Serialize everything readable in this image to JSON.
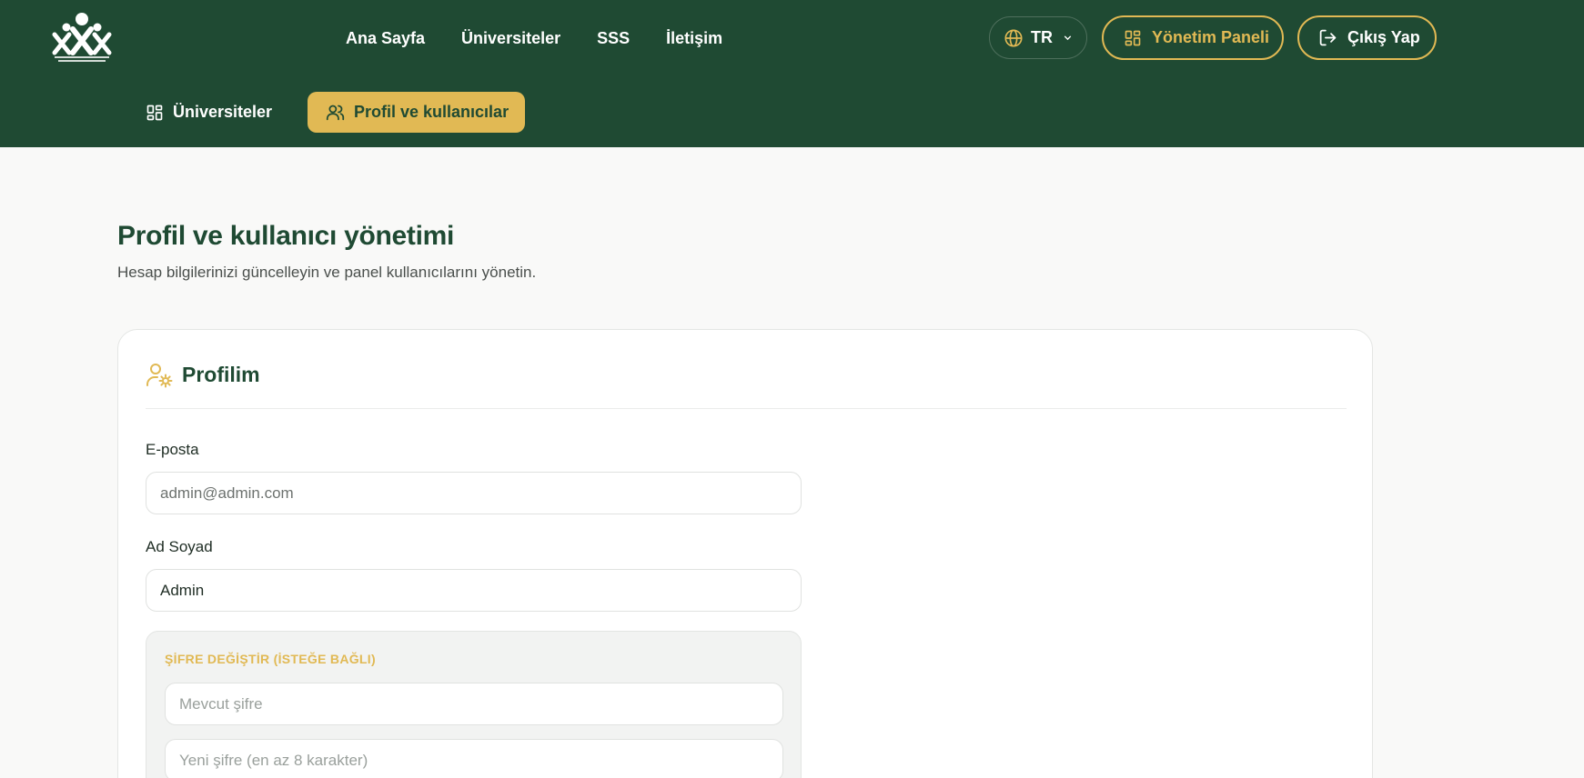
{
  "nav": {
    "items": [
      "Ana Sayfa",
      "Üniversiteler",
      "SSS",
      "İletişim"
    ]
  },
  "lang": {
    "label": "TR"
  },
  "actions": {
    "panel_label": "Yönetim Paneli",
    "logout_label": "Çıkış Yap"
  },
  "subnav": {
    "universities_label": "Üniversiteler",
    "profile_label": "Profil ve kullanıcılar"
  },
  "page": {
    "title": "Profil ve kullanıcı yönetimi",
    "subtitle": "Hesap bilgilerinizi güncelleyin ve panel kullanıcılarını yönetin."
  },
  "profile": {
    "title": "Profilim",
    "email_label": "E-posta",
    "email_value": "admin@admin.com",
    "name_label": "Ad Soyad",
    "name_value": "Admin",
    "password_section_label": "ŞİFRE DEĞİŞTİR (İSTEĞE BAĞLI)",
    "current_password_placeholder": "Mevcut şifre",
    "new_password_placeholder": "Yeni şifre (en az 8 karakter)"
  },
  "colors": {
    "header_bg": "#1f4a33",
    "accent": "#e1b954",
    "page_bg": "#f9f9f8"
  }
}
